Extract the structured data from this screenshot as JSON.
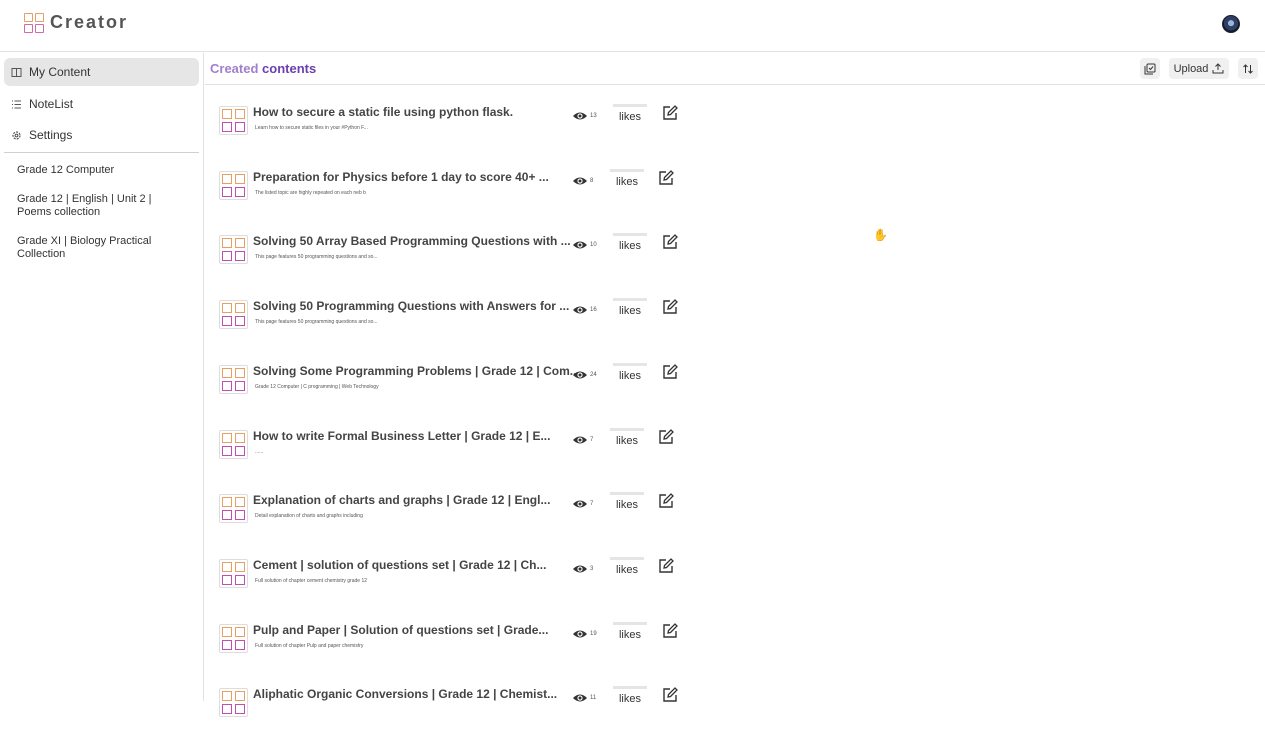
{
  "app": {
    "name": "Creator"
  },
  "sidebar": {
    "nav": [
      {
        "label": "My Content",
        "icon": "book-icon",
        "active": true
      },
      {
        "label": "NoteList",
        "icon": "list-icon",
        "active": false
      },
      {
        "label": "Settings",
        "icon": "gear-icon",
        "active": false
      }
    ],
    "collections": [
      {
        "label": "Grade 12 Computer"
      },
      {
        "label": "Grade 12 | English | Unit 2 | Poems collection"
      },
      {
        "label": "Grade XI | Biology Practical Collection"
      }
    ]
  },
  "main": {
    "title_part1": "Created",
    "title_part2": "contents",
    "toolbar": {
      "toggle_icon": "copy-check-icon",
      "upload_label": "Upload",
      "upload_icon": "upload-icon",
      "sort_icon": "sort-icon"
    },
    "likes_label": "likes",
    "rows": [
      {
        "title": "How to secure a static file using python flask.",
        "desc": "Learn how to secure static files in your #Python F...",
        "views": "13"
      },
      {
        "title": "Preparation for Physics before 1 day to score 40+ ...",
        "desc": "The listed topic are highly repeated on each neb b",
        "views": "8"
      },
      {
        "title": "Solving 50 Array Based Programming Questions with ...",
        "desc": "This page features 50 programming questions and so...",
        "views": "10"
      },
      {
        "title": "Solving 50 Programming Questions with Answers for ...",
        "desc": "This page features 50 programming questions and so...",
        "views": "16"
      },
      {
        "title": "Solving Some Programming Problems | Grade 12 | Com...",
        "desc": "Grade 12 Computer | C programming | Web Technology",
        "views": "24"
      },
      {
        "title": "How to write Formal Business Letter | Grade 12 | E...",
        "desc": "......",
        "views": "7"
      },
      {
        "title": "Explanation of charts and graphs | Grade 12 | Engl...",
        "desc": "Detail explanation of charts and graphs including",
        "views": "7"
      },
      {
        "title": "Cement | solution of questions set | Grade 12 | Ch...",
        "desc": "Full solution of chapter cement chemistry grade 12",
        "views": "3"
      },
      {
        "title": "Pulp and Paper | Solution of questions set | Grade...",
        "desc": "Full solution of chapter Pulp and paper chemistry",
        "views": "19"
      },
      {
        "title": "Aliphatic Organic Conversions | Grade 12 | Chemist...",
        "desc": "",
        "views": "11"
      }
    ]
  }
}
